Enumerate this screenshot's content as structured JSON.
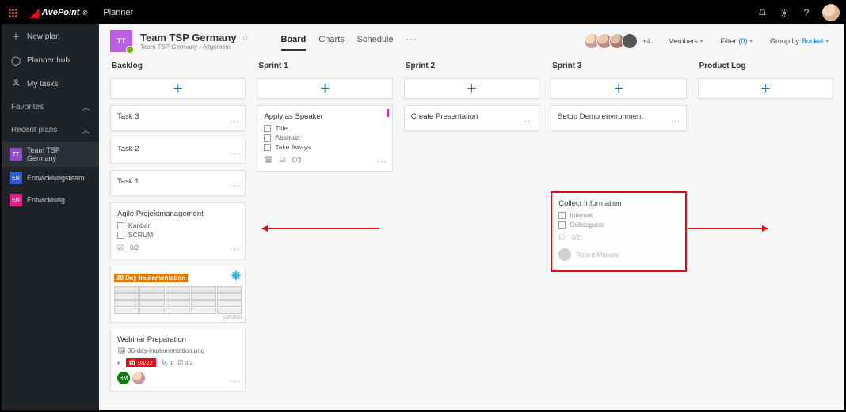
{
  "top": {
    "brand": "AvePoint",
    "app": "Planner"
  },
  "side": {
    "new_plan": "New plan",
    "planner_hub": "Planner hub",
    "my_tasks": "My tasks",
    "favorites": "Favorites",
    "recent": "Recent plans",
    "plans": [
      {
        "chip": "TT",
        "label": "Team TSP Germany"
      },
      {
        "chip": "EN",
        "label": "Entwicklungsteam"
      },
      {
        "chip": "EN",
        "label": "Entwicklung"
      }
    ]
  },
  "header": {
    "plan_chip": "TT",
    "plan_title": "Team TSP Germany",
    "breadcrumb_a": "Team TSP Germany",
    "breadcrumb_sep": "›",
    "breadcrumb_b": "Allgemein",
    "tabs": {
      "board": "Board",
      "charts": "Charts",
      "schedule": "Schedule",
      "more": "···"
    },
    "members_more": "+4",
    "members_label": "Members",
    "filter_label": "Filter",
    "filter_count": "(0)",
    "group_by_label": "Group by",
    "group_by_value": "Bucket"
  },
  "columns": {
    "backlog": {
      "title": "Backlog",
      "task3": "Task 3",
      "task2": "Task 2",
      "task1": "Task 1",
      "agile": {
        "title": "Agile Projektmanagement",
        "item1": "Kanban",
        "item2": "SCRUM",
        "progress": "0/2"
      },
      "webinar": {
        "banner": "30 Day Implementation",
        "title": "Webinar Preparation",
        "attachment": "30-day-implementation.png",
        "date": "08/22",
        "comments": "1",
        "check": "0/2",
        "av1": "RM"
      }
    },
    "sprint1": {
      "title": "Sprint 1",
      "speaker": {
        "title": "Apply as Speaker",
        "i1": "Title",
        "i2": "Abstract",
        "i3": "Take Aways",
        "progress": "0/3"
      }
    },
    "sprint2": {
      "title": "Sprint 2",
      "presentation": "Create Presentation"
    },
    "sprint3": {
      "title": "Sprint 3",
      "demo": "Setup Demo environment",
      "collect": {
        "title": "Collect Information",
        "i1": "Internet",
        "i2": "Colleagues",
        "progress": "0/2",
        "assignee": "Robert Mulsow"
      }
    },
    "product_log": {
      "title": "Product Log"
    }
  }
}
